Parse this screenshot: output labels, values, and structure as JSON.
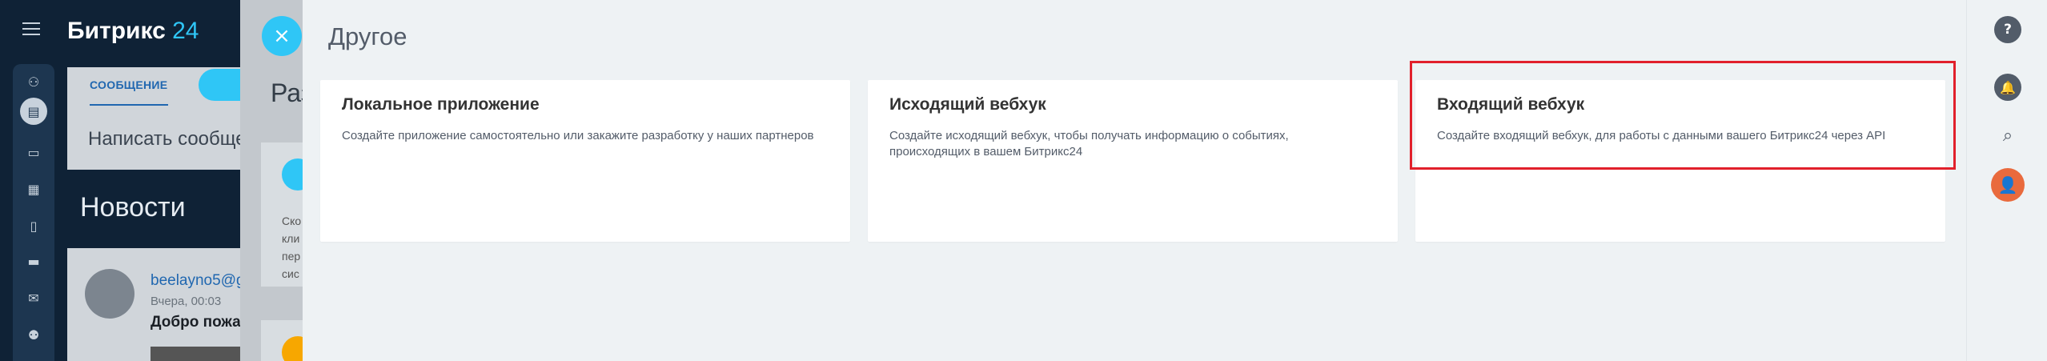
{
  "brand": {
    "name": "Битрикс",
    "num": "24"
  },
  "background": {
    "tab_label": "СООБЩЕНИЕ",
    "write_placeholder": "Написать сообще",
    "news_title": "Новости",
    "post_user": "beelayno5@g",
    "post_time": "Вчера, 00:03",
    "post_text": "Добро пожал",
    "mid_heading": "Раз",
    "mid_text": [
      "Ско",
      "кли",
      "пер",
      "сис"
    ]
  },
  "panel": {
    "title": "Другое",
    "cards": [
      {
        "title": "Локальное приложение",
        "description": "Создайте приложение самостоятельно или закажите разработку у наших партнеров"
      },
      {
        "title": "Исходящий вебхук",
        "description": "Создайте исходящий вебхук, чтобы получать информацию о событиях, происходящих в вашем Битрикс24"
      },
      {
        "title": "Входящий вебхук",
        "description": "Создайте входящий вебхук, для работы с данными вашего Битрикс24 через API"
      }
    ]
  },
  "icons": {
    "close": "×",
    "help": "?",
    "bell": "🔔",
    "search": "⌕"
  },
  "colors": {
    "accent": "#2fc6f6",
    "highlight": "#e1202b",
    "panel_bg": "#eef2f4"
  }
}
